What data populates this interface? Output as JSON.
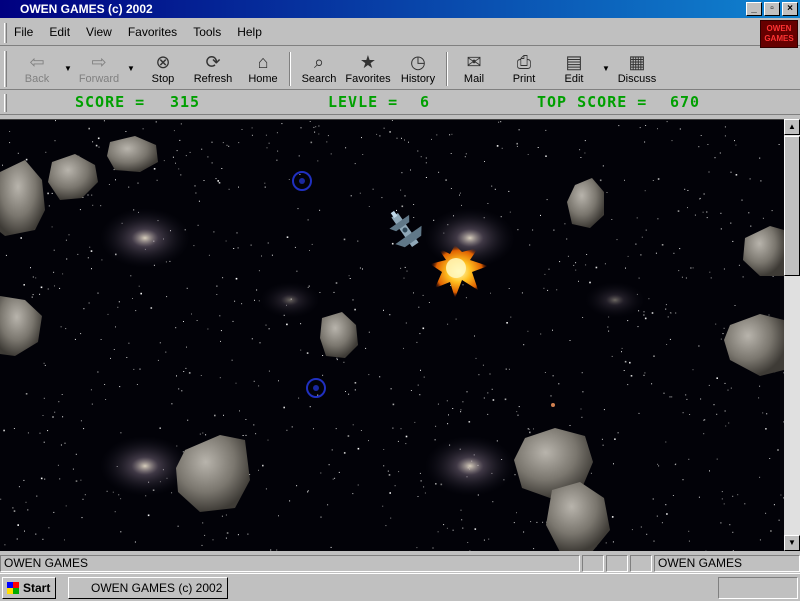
{
  "window": {
    "title": "OWEN GAMES (c) 2002"
  },
  "menu": [
    "File",
    "Edit",
    "View",
    "Favorites",
    "Tools",
    "Help"
  ],
  "logo_text": "OWEN GAMES",
  "toolbar": {
    "back": "Back",
    "forward": "Forward",
    "stop": "Stop",
    "refresh": "Refresh",
    "home": "Home",
    "search": "Search",
    "favorites": "Favorites",
    "history": "History",
    "mail": "Mail",
    "print": "Print",
    "edit": "Edit",
    "discuss": "Discuss"
  },
  "hud": {
    "score_label": "SCORE =",
    "score": "315",
    "level_label": "LEVLE =",
    "level": "6",
    "top_label": "TOP SCORE =",
    "top_score": "670"
  },
  "status": {
    "left": "OWEN GAMES",
    "right": "OWEN GAMES"
  },
  "taskbar": {
    "start": "Start",
    "task": "OWEN GAMES (c) 2002"
  }
}
